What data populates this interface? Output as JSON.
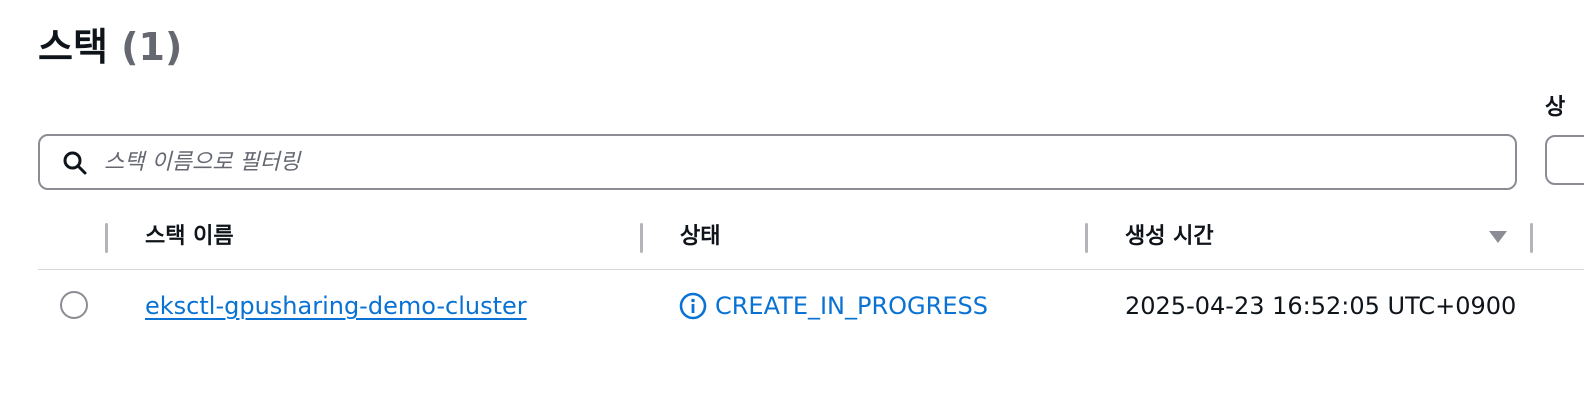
{
  "header": {
    "title": "스택",
    "count": "(1)",
    "right_filter_label": "상"
  },
  "search": {
    "placeholder": "스택 이름으로 필터링",
    "value": ""
  },
  "table": {
    "columns": [
      "스택 이름",
      "상태",
      "생성 시간"
    ],
    "sort_column": "생성 시간",
    "sort_direction": "descending",
    "rows": [
      {
        "selected": false,
        "stack_name": "eksctl-gpusharing-demo-cluster",
        "status": "CREATE_IN_PROGRESS",
        "status_icon": "info-icon",
        "created_time": "2025-04-23 16:52:05 UTC+0900"
      }
    ]
  },
  "colors": {
    "link": "#0972d3",
    "text": "#0f141a",
    "muted": "#656871",
    "border": "#8c8c94"
  }
}
